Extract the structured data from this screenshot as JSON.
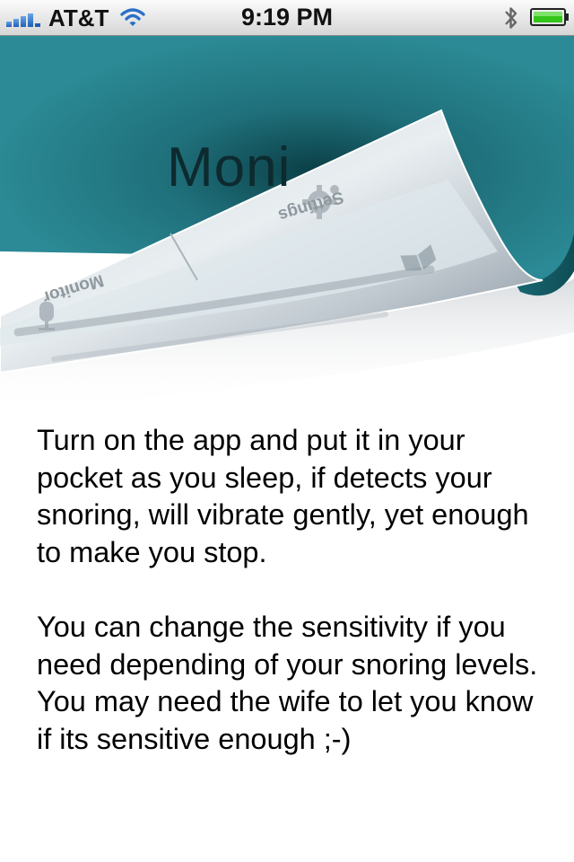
{
  "status_bar": {
    "carrier": "AT&T",
    "time": "9:19 PM",
    "signal_icon": "signal-bars-icon",
    "wifi_icon": "wifi-icon",
    "bluetooth_icon": "bluetooth-icon",
    "battery_icon": "battery-icon",
    "battery_color": "#34c51b"
  },
  "peeled_page": {
    "title": "Moni",
    "background_color": "#2b8a95",
    "back_tabs": [
      {
        "label": "Monitor",
        "icon": "microphone-icon"
      },
      {
        "label": "Settings",
        "icon": "gear-icon"
      },
      {
        "label": "",
        "icon": "book-icon"
      }
    ]
  },
  "description": {
    "paragraph_1": "Turn on the app and put it in your pocket as you sleep, if detects your snoring, will vibrate gently, yet enough to make you stop.",
    "paragraph_2": "You can change the sensitivity if you need depending of your snoring levels. You may need the wife to let you know if its sensitive enough ;-)"
  }
}
